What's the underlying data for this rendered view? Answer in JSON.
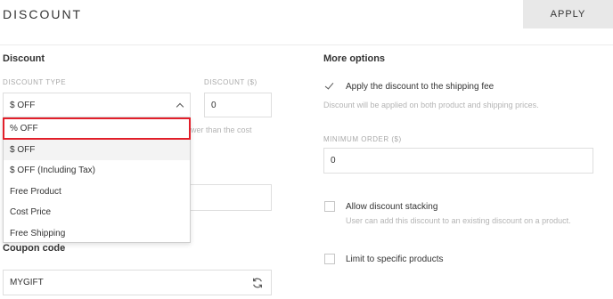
{
  "header": {
    "title": "DISCOUNT",
    "apply_label": "APPLY"
  },
  "discount_section": {
    "title": "Discount",
    "type_label": "DISCOUNT TYPE",
    "type_selected": "$ OFF",
    "amount_label": "DISCOUNT ($)",
    "amount_value": "0",
    "hint_partial": "wer than the cost",
    "dropdown_options": [
      "% OFF",
      "$ OFF",
      "$ OFF (Including Tax)",
      "Free Product",
      "Cost Price",
      "Free Shipping"
    ],
    "highlighted_option_color": "#e21f2a"
  },
  "coupon": {
    "title": "Coupon code",
    "value": "MYGIFT"
  },
  "more_options": {
    "title": "More options",
    "shipping_label": "Apply the discount to the shipping fee",
    "shipping_checked": true,
    "shipping_hint": "Discount will be applied on both product and shipping prices.",
    "min_order_label": "MINIMUM ORDER ($)",
    "min_order_value": "0",
    "stacking_label": "Allow discount stacking",
    "stacking_checked": false,
    "stacking_hint": "User can add this discount to an existing discount on a product.",
    "limit_label": "Limit to specific products",
    "limit_checked": false
  }
}
